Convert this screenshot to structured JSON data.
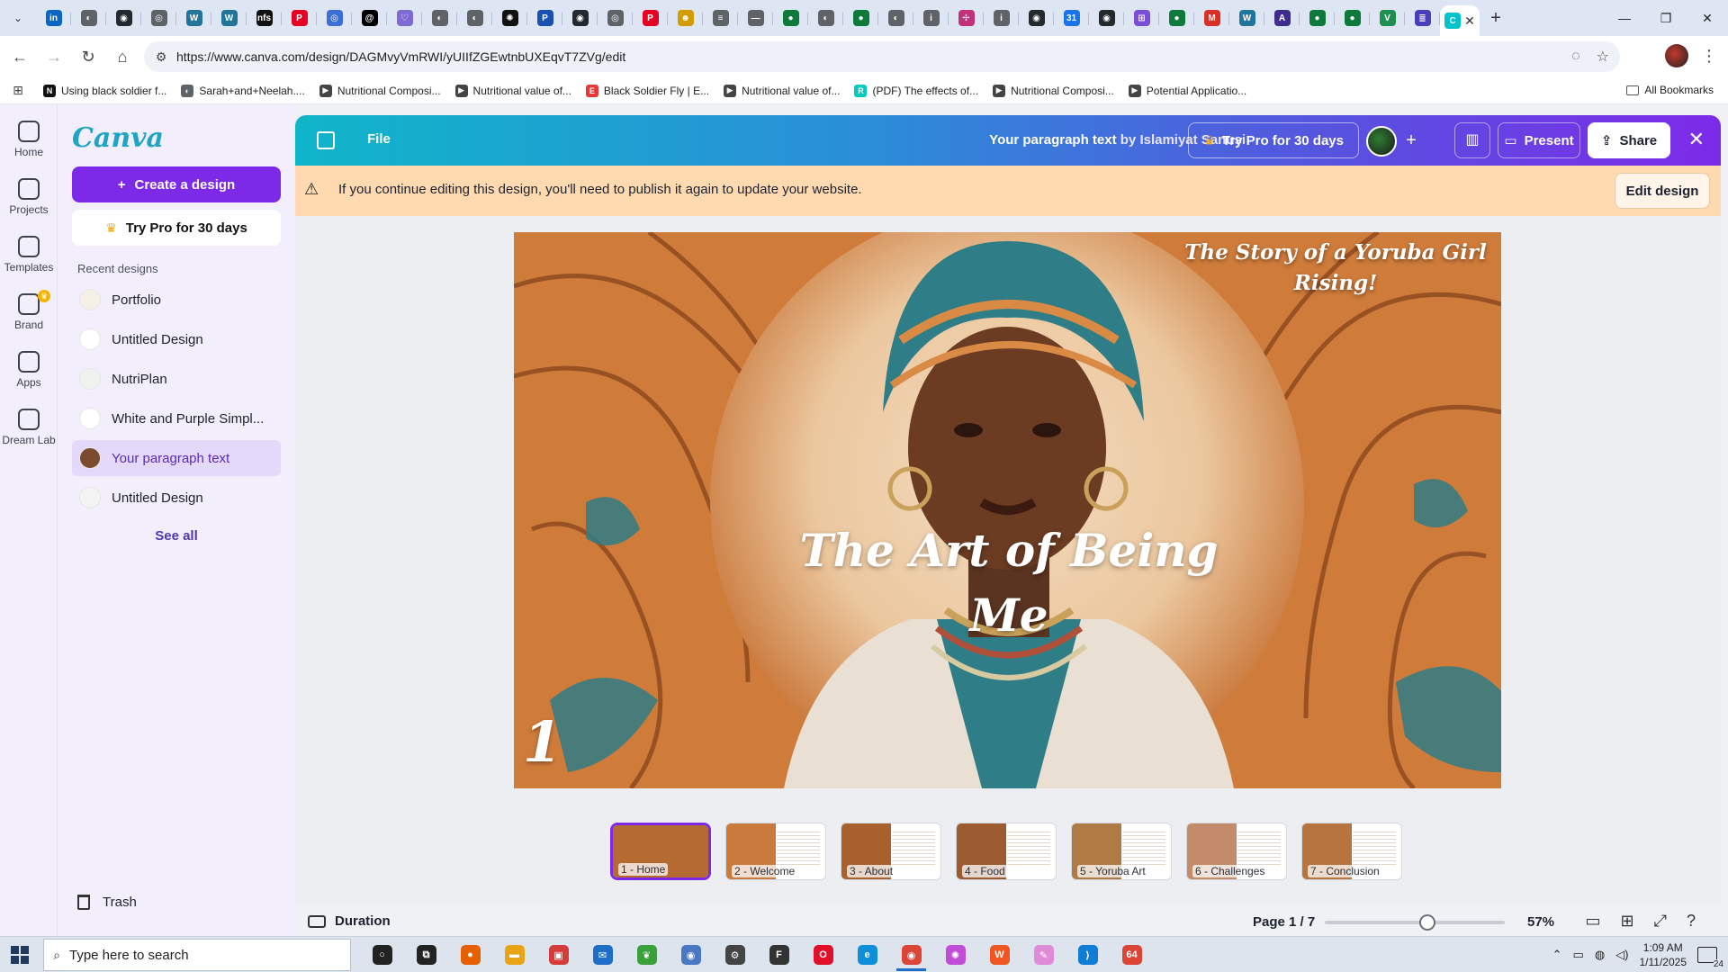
{
  "browser": {
    "pinned_tabs": [
      {
        "icon": "linkedin-icon",
        "color": "#0a66c2",
        "glyph": "in"
      },
      {
        "icon": "globe-icon",
        "color": "#5f6368",
        "glyph": "◐"
      },
      {
        "icon": "github-icon",
        "color": "#24292e",
        "glyph": "◉"
      },
      {
        "icon": "settings-icon",
        "color": "#5f6368",
        "glyph": "◎"
      },
      {
        "icon": "wordpress-icon",
        "color": "#21759b",
        "glyph": "W"
      },
      {
        "icon": "wordpress-icon",
        "color": "#21759b",
        "glyph": "W"
      },
      {
        "icon": "nfs-icon",
        "color": "#111111",
        "glyph": "nfs"
      },
      {
        "icon": "pinterest-icon",
        "color": "#e60023",
        "glyph": "P"
      },
      {
        "icon": "sites-icon",
        "color": "#3b6fd8",
        "glyph": "◎"
      },
      {
        "icon": "threads-icon",
        "color": "#000000",
        "glyph": "@"
      },
      {
        "icon": "heart-icon",
        "color": "#7d6bd1",
        "glyph": "♡"
      },
      {
        "icon": "globe-icon",
        "color": "#5f6368",
        "glyph": "◐"
      },
      {
        "icon": "globe-icon",
        "color": "#5f6368",
        "glyph": "◐"
      },
      {
        "icon": "openai-icon",
        "color": "#111111",
        "glyph": "✺"
      },
      {
        "icon": "paypal-icon",
        "color": "#1a4fb4",
        "glyph": "P"
      },
      {
        "icon": "github-icon",
        "color": "#24292e",
        "glyph": "◉"
      },
      {
        "icon": "settings-icon",
        "color": "#5f6368",
        "glyph": "◎"
      },
      {
        "icon": "pinterest-icon",
        "color": "#e60023",
        "glyph": "P"
      },
      {
        "icon": "emoji-icon",
        "color": "#d39b00",
        "glyph": "☻"
      },
      {
        "icon": "menu-icon",
        "color": "#5f6368",
        "glyph": "≡"
      },
      {
        "icon": "dash-icon",
        "color": "#5f6368",
        "glyph": "—"
      },
      {
        "icon": "leaf-icon",
        "color": "#0d7a3b",
        "glyph": "●"
      },
      {
        "icon": "globe-icon",
        "color": "#5f6368",
        "glyph": "◐"
      },
      {
        "icon": "leaf-icon",
        "color": "#0d7a3b",
        "glyph": "●"
      },
      {
        "icon": "globe-icon",
        "color": "#5f6368",
        "glyph": "◐"
      },
      {
        "icon": "info-icon",
        "color": "#5f6368",
        "glyph": "i"
      },
      {
        "icon": "slack-icon",
        "color": "#c2327a",
        "glyph": "✢"
      },
      {
        "icon": "info-icon",
        "color": "#5f6368",
        "glyph": "i"
      },
      {
        "icon": "github-icon",
        "color": "#24292e",
        "glyph": "◉"
      },
      {
        "icon": "calendar-icon",
        "color": "#1a73e8",
        "glyph": "31"
      },
      {
        "icon": "github-icon",
        "color": "#24292e",
        "glyph": "◉"
      },
      {
        "icon": "grid-icon",
        "color": "#7a4fd6",
        "glyph": "⊞"
      },
      {
        "icon": "leaf-icon",
        "color": "#0d7a3b",
        "glyph": "●"
      },
      {
        "icon": "gmail-icon",
        "color": "#d93025",
        "glyph": "M"
      },
      {
        "icon": "wordpress-icon",
        "color": "#21759b",
        "glyph": "W"
      },
      {
        "icon": "font-icon",
        "color": "#3f2c8f",
        "glyph": "A"
      },
      {
        "icon": "leaf-icon",
        "color": "#0d7a3b",
        "glyph": "●"
      },
      {
        "icon": "leaf-icon",
        "color": "#0d7a3b",
        "glyph": "●"
      },
      {
        "icon": "vine-icon",
        "color": "#1e8f4e",
        "glyph": "V"
      },
      {
        "icon": "notes-icon",
        "color": "#4a3fb8",
        "glyph": "≣"
      }
    ],
    "active_tab": {
      "icon": "canva-icon",
      "color": "#00c4cc",
      "glyph": "C"
    },
    "url": "https://www.canva.com/design/DAGMvyVmRWI/yUIIfZGEwtnbUXEqvT7ZVg/edit",
    "bookmarks": [
      {
        "label": "Using black soldier f...",
        "icon": "notion-icon",
        "color": "#111111",
        "glyph": "N"
      },
      {
        "label": "Sarah+and+Neelah....",
        "icon": "globe-icon",
        "color": "#5f6368",
        "glyph": "◐"
      },
      {
        "label": "Nutritional Composi...",
        "icon": "bookmark-icon",
        "color": "#444444",
        "glyph": "▶"
      },
      {
        "label": "Nutritional value of...",
        "icon": "bookmark-icon",
        "color": "#444444",
        "glyph": "▶"
      },
      {
        "label": "Black Soldier Fly | E...",
        "icon": "elsevier-icon",
        "color": "#e53935",
        "glyph": "E"
      },
      {
        "label": "Nutritional value of...",
        "icon": "bookmark-icon",
        "color": "#444444",
        "glyph": "▶"
      },
      {
        "label": "(PDF) The effects of...",
        "icon": "researchgate-icon",
        "color": "#00ccbb",
        "glyph": "R"
      },
      {
        "label": "Nutritional Composi...",
        "icon": "bookmark-icon",
        "color": "#444444",
        "glyph": "▶"
      },
      {
        "label": "Potential Applicatio...",
        "icon": "bookmark-icon",
        "color": "#444444",
        "glyph": "▶"
      }
    ],
    "all_bookmarks": "All Bookmarks"
  },
  "canva": {
    "rail": [
      {
        "label": "Home",
        "icon": "home-icon"
      },
      {
        "label": "Projects",
        "icon": "folder-icon"
      },
      {
        "label": "Templates",
        "icon": "templates-icon"
      },
      {
        "label": "Brand",
        "icon": "brand-icon"
      },
      {
        "label": "Apps",
        "icon": "apps-icon"
      },
      {
        "label": "Dream Lab",
        "icon": "dream-lab-icon"
      }
    ],
    "logo": "Canva",
    "create_label": "Create a design",
    "pro_label": "Try Pro for 30 days",
    "recent_heading": "Recent designs",
    "recent": [
      {
        "label": "Portfolio",
        "active": false
      },
      {
        "label": "Untitled Design",
        "active": false
      },
      {
        "label": "NutriPlan",
        "active": false
      },
      {
        "label": "White and Purple Simpl...",
        "active": false
      },
      {
        "label": "Your paragraph text",
        "active": true
      },
      {
        "label": "Untitled Design",
        "active": false
      }
    ],
    "see_all": "See all",
    "trash": "Trash"
  },
  "editor": {
    "file": "File",
    "design_title": "Your paragraph text",
    "by_author": "by Islamiyat Sanusi",
    "try_pro": "Try Pro for 30 days",
    "present": "Present",
    "share": "Share",
    "banner_text": "If you continue editing this design, you'll need to publish it again to update your website.",
    "edit_design": "Edit design"
  },
  "slide": {
    "title": "The Art of Being Me",
    "subtitle": "The Story of a Yoruba Girl Rising!",
    "number": "1"
  },
  "pages": [
    {
      "label": "1 - Home",
      "active": true
    },
    {
      "label": "2 - Welcome",
      "active": false
    },
    {
      "label": "3 - About",
      "active": false
    },
    {
      "label": "4 - Food",
      "active": false
    },
    {
      "label": "5 - Yoruba Art",
      "active": false
    },
    {
      "label": "6 - Challenges",
      "active": false
    },
    {
      "label": "7 - Conclusion",
      "active": false
    }
  ],
  "status": {
    "duration": "Duration",
    "page_indicator": "Page 1 / 7",
    "zoom": "57%",
    "zoom_level": 0.57
  },
  "taskbar": {
    "search_placeholder": "Type here to search",
    "apps": [
      {
        "icon": "cortana-icon",
        "color": "#222222",
        "glyph": "○"
      },
      {
        "icon": "task-view-icon",
        "color": "#222222",
        "glyph": "⧉"
      },
      {
        "icon": "firefox-icon",
        "color": "#e66000",
        "glyph": "●"
      },
      {
        "icon": "file-explorer-icon",
        "color": "#e8a317",
        "glyph": "▬"
      },
      {
        "icon": "gift-icon",
        "color": "#d63b3b",
        "glyph": "▣"
      },
      {
        "icon": "mail-icon",
        "color": "#1e6ec8",
        "glyph": "✉"
      },
      {
        "icon": "feather-icon",
        "color": "#3aa03a",
        "glyph": "❦"
      },
      {
        "icon": "browser-icon",
        "color": "#4a78c2",
        "glyph": "◉"
      },
      {
        "icon": "settings-icon",
        "color": "#444444",
        "glyph": "⚙"
      },
      {
        "icon": "terminal-icon",
        "color": "#333333",
        "glyph": "F"
      },
      {
        "icon": "opera-icon",
        "color": "#e0102b",
        "glyph": "O"
      },
      {
        "icon": "edge-icon",
        "color": "#0c8fd8",
        "glyph": "e"
      },
      {
        "icon": "chrome-icon",
        "color": "#db4437",
        "glyph": "◉"
      },
      {
        "icon": "color-wheel-icon",
        "color": "#c04dd6",
        "glyph": "✺"
      },
      {
        "icon": "brave-icon",
        "color": "#f05522",
        "glyph": "W"
      },
      {
        "icon": "pen-icon",
        "color": "#e08bd8",
        "glyph": "✎"
      },
      {
        "icon": "vscode-icon",
        "color": "#0f7cd6",
        "glyph": "⟩"
      },
      {
        "icon": "chrome-badge-icon",
        "color": "#db4437",
        "glyph": "64"
      }
    ],
    "time": "1:09 AM",
    "date": "1/11/2025",
    "notifications": "24"
  }
}
